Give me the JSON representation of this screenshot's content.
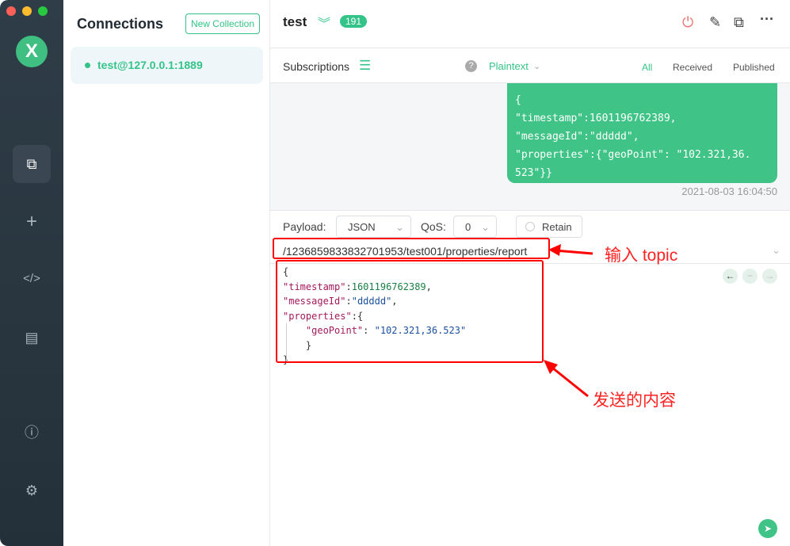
{
  "window": {
    "controls": [
      "close",
      "minimize",
      "maximize"
    ]
  },
  "sidebar": {
    "logo": "X",
    "items": [
      {
        "icon": "connections-icon",
        "active": true
      },
      {
        "icon": "plus-icon"
      },
      {
        "icon": "code-icon"
      },
      {
        "icon": "log-icon"
      },
      {
        "icon": "info-icon"
      },
      {
        "icon": "gear-icon"
      }
    ]
  },
  "connections": {
    "title": "Connections",
    "new_collection": "New Collection",
    "items": [
      {
        "label": "test@127.0.0.1:1889",
        "status": "connected"
      }
    ]
  },
  "header": {
    "title": "test",
    "count": "191"
  },
  "subbar": {
    "subscriptions": "Subscriptions",
    "format": "Plaintext",
    "filters": [
      "All",
      "Received",
      "Published"
    ],
    "active_filter": "All"
  },
  "messages": [
    {
      "body": "{\n\"timestamp\":1601196762389,\n\"messageId\":\"ddddd\",\n\"properties\":{\"geoPoint\": \"102.321,36.\n523\"}}",
      "time": "2021-08-03 16:04:50",
      "direction": "published"
    }
  ],
  "composer": {
    "payload_label": "Payload:",
    "payload_type": "JSON",
    "qos_label": "QoS:",
    "qos": "0",
    "retain": "Retain",
    "topic": "/1236859833832701953/test001/properties/report",
    "lines": [
      [
        "{"
      ],
      [
        "\"timestamp\"",
        ":",
        "1601196762389",
        ","
      ],
      [
        "\"messageId\"",
        ":",
        "\"ddddd\"",
        ","
      ],
      [
        "\"properties\"",
        ":{"
      ],
      [
        "    \"geoPoint\"",
        ": ",
        "\"102.321,36.523\""
      ],
      [
        "    }"
      ],
      [
        "}"
      ]
    ]
  },
  "annotations": {
    "topic": "输入 topic",
    "content": "发送的内容"
  },
  "colors": {
    "accent": "#34c388",
    "annotation": "#ff0000",
    "sidebar": "#2f3d48"
  }
}
